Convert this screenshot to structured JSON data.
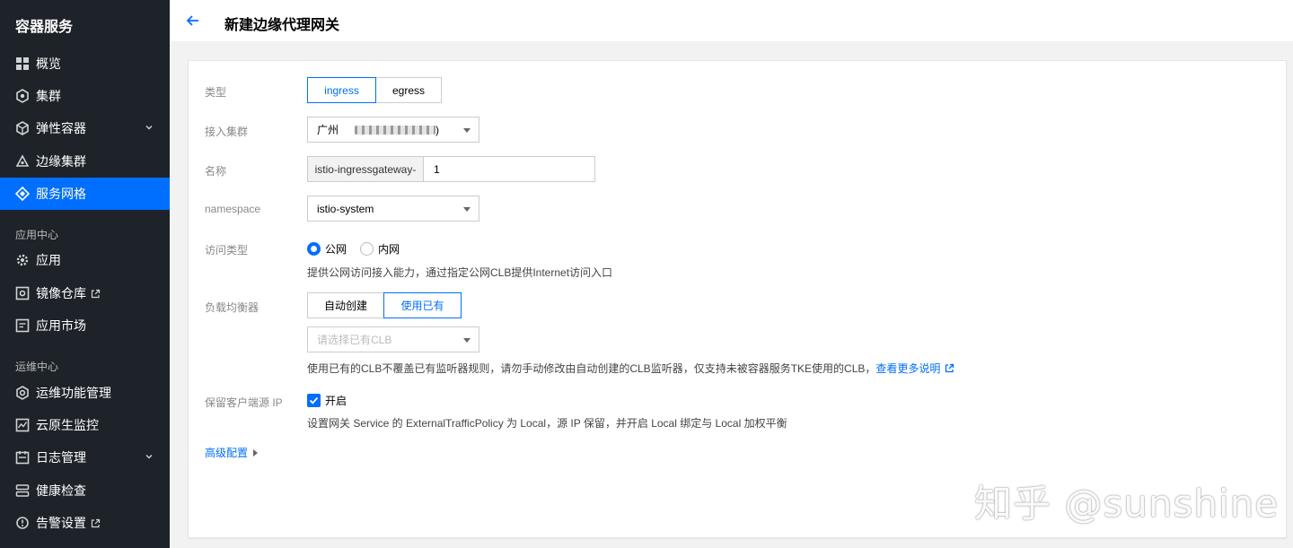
{
  "sidebar": {
    "brand": "容器服务",
    "items": [
      {
        "label": "概览",
        "icon": "grid-icon"
      },
      {
        "label": "集群",
        "icon": "hexagon-icon"
      },
      {
        "label": "弹性容器",
        "icon": "cube-icon"
      },
      {
        "label": "边缘集群",
        "icon": "edge-cluster-icon"
      },
      {
        "label": "服务网格",
        "icon": "mesh-icon"
      }
    ],
    "group_app": "应用中心",
    "app_items": [
      {
        "label": "应用",
        "icon": "gear-icon"
      },
      {
        "label": "镜像仓库",
        "icon": "registry-icon"
      },
      {
        "label": "应用市场",
        "icon": "market-icon"
      }
    ],
    "group_ops": "运维中心",
    "ops_items": [
      {
        "label": "运维功能管理",
        "icon": "settings-icon"
      },
      {
        "label": "云原生监控",
        "icon": "monitor-icon"
      },
      {
        "label": "日志管理",
        "icon": "calendar-icon"
      },
      {
        "label": "健康检查",
        "icon": "health-icon"
      },
      {
        "label": "告警设置",
        "icon": "alarm-icon"
      }
    ],
    "active_color": "#006eff"
  },
  "header": {
    "title": "新建边缘代理网关"
  },
  "form": {
    "type_label": "类型",
    "type_options": [
      "ingress",
      "egress"
    ],
    "type_selected": "ingress",
    "cluster_label": "接入集群",
    "cluster_value_prefix": "广州",
    "cluster_value_suffix": ")",
    "name_label": "名称",
    "name_prefix": "istio-ingressgateway-",
    "name_value": "1",
    "namespace_label": "namespace",
    "namespace_value": "istio-system",
    "access_label": "访问类型",
    "access_options": [
      "公网",
      "内网"
    ],
    "access_selected": "公网",
    "access_hint": "提供公网访问接入能力，通过指定公网CLB提供Internet访问入口",
    "lb_label": "负载均衡器",
    "lb_options": [
      "自动创建",
      "使用已有"
    ],
    "lb_selected": "使用已有",
    "clb_placeholder": "请选择已有CLB",
    "clb_hint": "使用已有的CLB不覆盖已有监听器规则，请勿手动修改由自动创建的CLB监听器，仅支持未被容器服务TKE使用的CLB，",
    "clb_link": "查看更多说明",
    "preserve_ip_label": "保留客户端源 IP",
    "preserve_ip_checkbox": "开启",
    "preserve_ip_checked": true,
    "preserve_ip_hint": "设置网关 Service 的 ExternalTrafficPolicy 为 Local，源 IP 保留，并开启 Local 绑定与 Local 加权平衡",
    "advanced": "高级配置"
  },
  "watermark": "知乎 @sunshine"
}
